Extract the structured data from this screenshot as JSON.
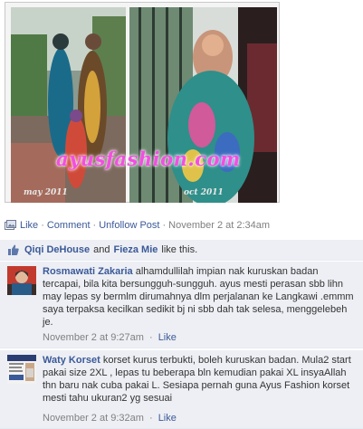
{
  "post": {
    "watermark": "ayusfashion.com",
    "photo_left_date": "may 2011",
    "photo_right_date": "oct 2011",
    "actions": {
      "like": "Like",
      "comment": "Comment",
      "unfollow": "Unfollow Post",
      "timestamp": "November 2 at 2:34am"
    }
  },
  "likes": {
    "user1": "Qiqi DeHouse",
    "and": "and",
    "user2": "Fieza Mie",
    "suffix": "like this."
  },
  "comments": [
    {
      "author": "Rosmawati Zakaria",
      "text": "alhamdullilah impian nak kuruskan badan tercapai, bila kita bersungguh-sungguh. ayus mesti perasan sbb lihn may lepas sy bermlm dirumahnya dlm perjalanan ke Langkawi .emmm saya terpaksa kecilkan sedikit bj ni sbb dah tak selesa, menggelebeh je.",
      "timestamp": "November 2 at 9:27am",
      "like_label": "Like"
    },
    {
      "author": "Waty Korset",
      "text": "korset kurus terbukti, boleh kuruskan badan. Mula2 start pakai size 2XL , lepas tu beberapa bln kemudian pakai XL insyaAllah thn baru nak cuba pakai L. Sesiapa pernah guna Ayus Fashion korset mesti tahu ukuran2 yg sesuai",
      "timestamp": "November 2 at 9:32am",
      "like_label": "Like"
    }
  ],
  "colors": {
    "link": "#3b5998",
    "meta_gray": "#808080",
    "feedback_bg": "#edeff4",
    "watermark": "#f24fe1"
  },
  "icons": {
    "share": "photo-share-icon",
    "like": "thumbs-up-icon"
  }
}
